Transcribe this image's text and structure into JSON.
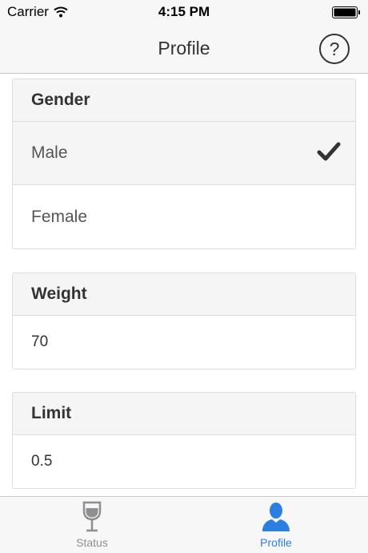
{
  "status_bar": {
    "carrier": "Carrier",
    "time": "4:15 PM"
  },
  "nav": {
    "title": "Profile",
    "help_icon": "help-circle-icon"
  },
  "gender": {
    "heading": "Gender",
    "options": [
      {
        "label": "Male",
        "selected": true
      },
      {
        "label": "Female",
        "selected": false
      }
    ]
  },
  "weight": {
    "heading": "Weight",
    "value": "70"
  },
  "limit": {
    "heading": "Limit",
    "value": "0.5"
  },
  "tabs": [
    {
      "label": "Status",
      "icon": "wine-glass-icon",
      "active": false
    },
    {
      "label": "Profile",
      "icon": "person-icon",
      "active": true
    }
  ],
  "colors": {
    "accent": "#2b7fe0",
    "tab_inactive": "#8e8e93",
    "panel_heading_bg": "#f5f5f5"
  }
}
